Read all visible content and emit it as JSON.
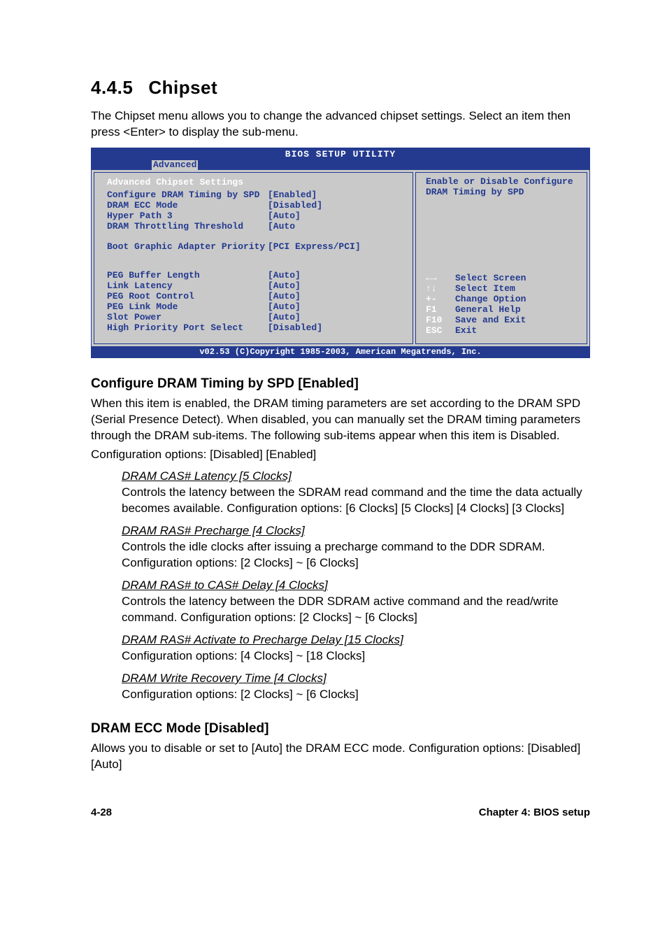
{
  "section": {
    "number": "4.4.5",
    "title": "Chipset"
  },
  "intro": "The Chipset menu allows you to change the advanced chipset settings. Select an item then press <Enter> to display the sub-menu.",
  "bios": {
    "title": "BIOS SETUP UTILITY",
    "tab": "Advanced",
    "heading": "Advanced Chipset Settings",
    "items1": [
      {
        "label": "Configure DRAM Timing by SPD",
        "value": "[Enabled]"
      },
      {
        "label": "DRAM ECC Mode",
        "value": "[Disabled]"
      },
      {
        "label": "Hyper Path 3",
        "value": "[Auto]"
      },
      {
        "label": "DRAM Throttling Threshold",
        "value": "[Auto"
      }
    ],
    "items2": [
      {
        "label": "Boot Graphic Adapter Priority",
        "value": "[PCI Express/PCI]"
      }
    ],
    "items3": [
      {
        "label": "PEG Buffer Length",
        "value": "[Auto]"
      },
      {
        "label": "Link Latency",
        "value": "[Auto]"
      },
      {
        "label": "PEG Root Control",
        "value": "[Auto]"
      },
      {
        "label": "PEG Link Mode",
        "value": "[Auto]"
      },
      {
        "label": "Slot Power",
        "value": "[Auto]"
      },
      {
        "label": "High Priority Port Select",
        "value": "[Disabled]"
      }
    ],
    "help": "Enable or Disable Configure DRAM Timing by SPD",
    "nav": [
      {
        "key": "←→",
        "desc": "Select Screen"
      },
      {
        "key": "↑↓",
        "desc": "Select Item"
      },
      {
        "key": "+-",
        "desc": "Change Option"
      },
      {
        "key": "F1",
        "desc": "General Help"
      },
      {
        "key": "F10",
        "desc": "Save and Exit"
      },
      {
        "key": "ESC",
        "desc": "Exit"
      }
    ],
    "footer": "v02.53 (C)Copyright 1985-2003, American Megatrends, Inc."
  },
  "opt1": {
    "heading": "Configure DRAM Timing by SPD [Enabled]",
    "desc": "When this item is enabled, the DRAM timing parameters are set according to the DRAM SPD (Serial Presence Detect). When disabled, you can manually set the DRAM timing parameters through the DRAM sub-items. The following sub-items appear when this item is Disabled.",
    "opts": "Configuration options: [Disabled] [Enabled]",
    "subs": [
      {
        "head": "DRAM CAS# Latency [5 Clocks]",
        "desc": "Controls the latency between the SDRAM read command and the time the data actually becomes available. Configuration options: [6 Clocks] [5 Clocks] [4 Clocks] [3 Clocks]"
      },
      {
        "head": "DRAM RAS# Precharge [4 Clocks]",
        "desc": "Controls the idle clocks after issuing a precharge command to the DDR SDRAM. Configuration options: [2 Clocks] ~ [6 Clocks]"
      },
      {
        "head": "DRAM RAS# to CAS# Delay [4 Clocks]",
        "desc": "Controls the latency between the DDR SDRAM active command and the read/write command. Configuration options: [2 Clocks] ~ [6 Clocks]"
      },
      {
        "head": "DRAM RAS# Activate to Precharge Delay [15 Clocks]",
        "desc": "Configuration options: [4 Clocks] ~ [18 Clocks]"
      },
      {
        "head": "DRAM Write Recovery Time [4 Clocks]",
        "desc": "Configuration options: [2 Clocks] ~ [6 Clocks]"
      }
    ]
  },
  "opt2": {
    "heading": "DRAM ECC Mode [Disabled]",
    "desc": "Allows you to disable or set to [Auto] the DRAM ECC mode. Configuration options: [Disabled] [Auto]"
  },
  "footer": {
    "page": "4-28",
    "chapter": "Chapter 4: BIOS setup"
  }
}
